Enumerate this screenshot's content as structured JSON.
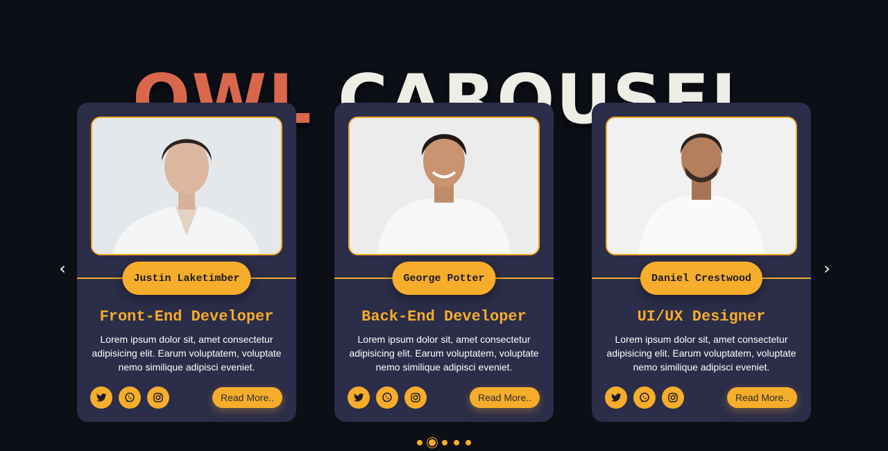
{
  "title": {
    "part1": "OWL",
    "part2": "CAROUSEL"
  },
  "nav": {
    "prev": "‹",
    "next": "›"
  },
  "colors": {
    "background": "#0d0f17",
    "card": "#2b2d49",
    "accent": "#f6ad2b",
    "title_accent": "#d9674c"
  },
  "cards": [
    {
      "name": "Justin Laketimber",
      "role": "Front-End Developer",
      "description": "Lorem ipsum dolor sit, amet consectetur adipisicing elit. Earum voluptatem, voluptate nemo similique adipisci eveniet.",
      "button": "Read More..",
      "socials": [
        "twitter-icon",
        "whatsapp-icon",
        "instagram-icon"
      ]
    },
    {
      "name": "George Potter",
      "role": "Back-End Developer",
      "description": "Lorem ipsum dolor sit, amet consectetur adipisicing elit. Earum voluptatem, voluptate nemo similique adipisci eveniet.",
      "button": "Read More..",
      "socials": [
        "twitter-icon",
        "whatsapp-icon",
        "instagram-icon"
      ]
    },
    {
      "name": "Daniel Crestwood",
      "role": "UI/UX Designer",
      "description": "Lorem ipsum dolor sit, amet consectetur adipisicing elit. Earum voluptatem, voluptate nemo similique adipisci eveniet.",
      "button": "Read More..",
      "socials": [
        "twitter-icon",
        "whatsapp-icon",
        "instagram-icon"
      ]
    }
  ],
  "pagination": {
    "count": 5,
    "active_index": 1
  }
}
